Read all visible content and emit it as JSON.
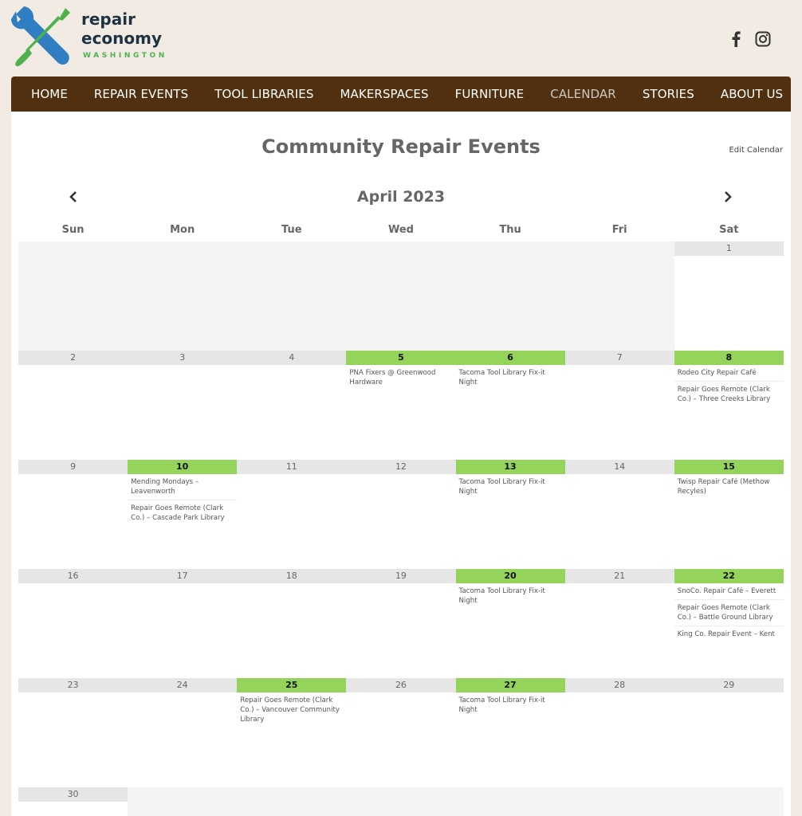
{
  "logo": {
    "line1": "repair",
    "line2": "economy",
    "line3": "WASHINGTON"
  },
  "social": [
    "facebook-icon",
    "instagram-icon"
  ],
  "nav": [
    {
      "label": "HOME",
      "active": false
    },
    {
      "label": "REPAIR EVENTS",
      "active": false
    },
    {
      "label": "TOOL LIBRARIES",
      "active": false
    },
    {
      "label": "MAKERSPACES",
      "active": false
    },
    {
      "label": "FURNITURE",
      "active": false
    },
    {
      "label": "CALENDAR",
      "active": true
    },
    {
      "label": "STORIES",
      "active": false
    },
    {
      "label": "ABOUT US",
      "active": false
    }
  ],
  "page": {
    "title": "Community Repair Events",
    "edit_link": "Edit Calendar"
  },
  "calendar": {
    "month_label": "April 2023",
    "weekdays": [
      "Sun",
      "Mon",
      "Tue",
      "Wed",
      "Thu",
      "Fri",
      "Sat"
    ],
    "weeks": [
      [
        {
          "day": "",
          "events": []
        },
        {
          "day": "",
          "events": []
        },
        {
          "day": "",
          "events": []
        },
        {
          "day": "",
          "events": []
        },
        {
          "day": "",
          "events": []
        },
        {
          "day": "",
          "events": []
        },
        {
          "day": "1",
          "events": []
        }
      ],
      [
        {
          "day": "2",
          "events": []
        },
        {
          "day": "3",
          "events": []
        },
        {
          "day": "4",
          "events": []
        },
        {
          "day": "5",
          "events": [
            "PNA Fixers @ Greenwood Hardware"
          ]
        },
        {
          "day": "6",
          "events": [
            "Tacoma Tool Library Fix-it Night"
          ]
        },
        {
          "day": "7",
          "events": []
        },
        {
          "day": "8",
          "events": [
            "Rodeo City Repair Café",
            "Repair Goes Remote (Clark Co.) – Three Creeks Library"
          ]
        }
      ],
      [
        {
          "day": "9",
          "events": []
        },
        {
          "day": "10",
          "events": [
            "Mending Mondays – Leavenworth",
            "Repair Goes Remote (Clark Co.) – Cascade Park Library"
          ]
        },
        {
          "day": "11",
          "events": []
        },
        {
          "day": "12",
          "events": []
        },
        {
          "day": "13",
          "events": [
            "Tacoma Tool Library Fix-it Night"
          ]
        },
        {
          "day": "14",
          "events": []
        },
        {
          "day": "15",
          "events": [
            "Twisp Repair Café (Methow Recyles)"
          ]
        }
      ],
      [
        {
          "day": "16",
          "events": []
        },
        {
          "day": "17",
          "events": []
        },
        {
          "day": "18",
          "events": []
        },
        {
          "day": "19",
          "events": []
        },
        {
          "day": "20",
          "events": [
            "Tacoma Tool Library Fix-it Night"
          ]
        },
        {
          "day": "21",
          "events": []
        },
        {
          "day": "22",
          "events": [
            "SnoCo. Repair Café – Everett",
            "Repair Goes Remote (Clark Co.) – Battle Ground Library",
            "King Co. Repair Event – Kent"
          ]
        }
      ],
      [
        {
          "day": "23",
          "events": []
        },
        {
          "day": "24",
          "events": []
        },
        {
          "day": "25",
          "events": [
            "Repair Goes Remote (Clark Co.) – Vancouver Community Library"
          ]
        },
        {
          "day": "26",
          "events": []
        },
        {
          "day": "27",
          "events": [
            "Tacoma Tool Library Fix-it Night"
          ]
        },
        {
          "day": "28",
          "events": []
        },
        {
          "day": "29",
          "events": []
        }
      ],
      [
        {
          "day": "30",
          "events": []
        },
        {
          "day": "",
          "events": []
        },
        {
          "day": "",
          "events": []
        },
        {
          "day": "",
          "events": []
        },
        {
          "day": "",
          "events": []
        },
        {
          "day": "",
          "events": []
        },
        {
          "day": "",
          "events": []
        }
      ]
    ]
  },
  "colors": {
    "nav_bg": "#51300f",
    "event_day": "#94d45a",
    "page_bg": "#f2ebe3"
  }
}
